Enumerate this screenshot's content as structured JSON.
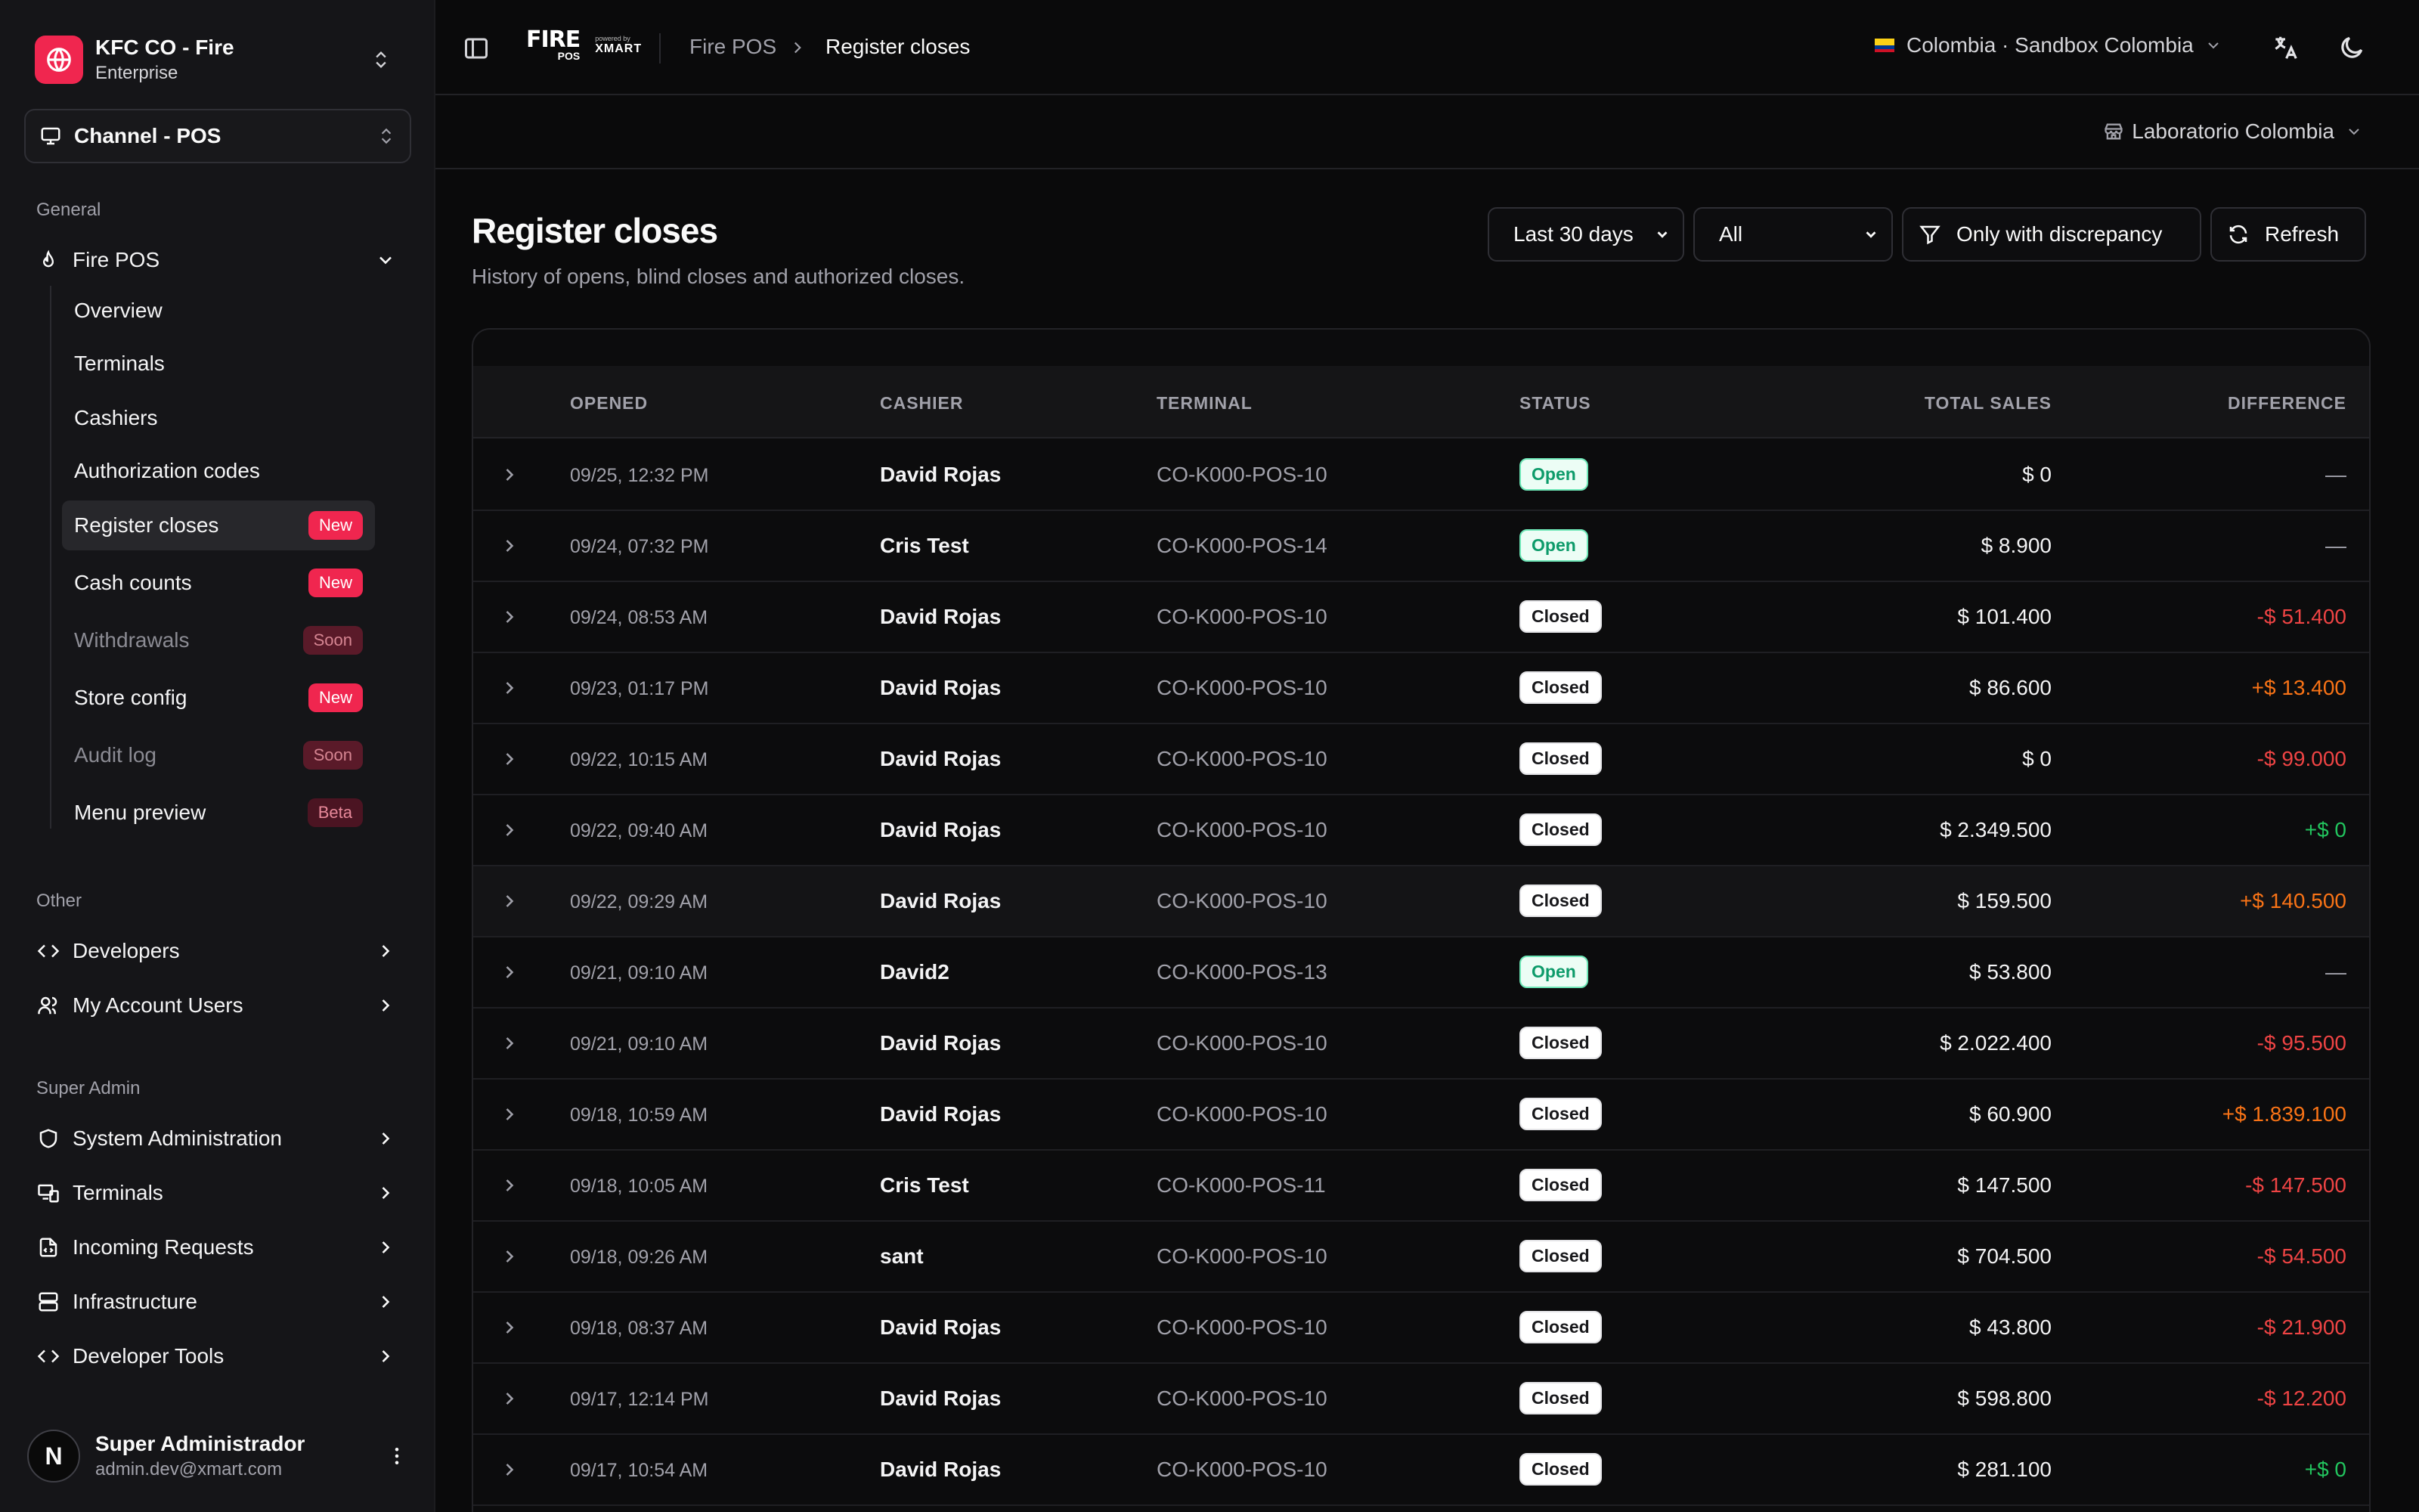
{
  "org": {
    "name": "KFC CO - Fire",
    "plan": "Enterprise"
  },
  "channel": {
    "label": "Channel - POS"
  },
  "sidebar": {
    "general_label": "General",
    "fire_pos": "Fire POS",
    "sub_items": [
      {
        "label": "Overview",
        "badge": "",
        "badge_type": "",
        "muted": false,
        "active": false
      },
      {
        "label": "Terminals",
        "badge": "",
        "badge_type": "",
        "muted": false,
        "active": false
      },
      {
        "label": "Cashiers",
        "badge": "",
        "badge_type": "",
        "muted": false,
        "active": false
      },
      {
        "label": "Authorization codes",
        "badge": "",
        "badge_type": "",
        "muted": false,
        "active": false
      },
      {
        "label": "Register closes",
        "badge": "New",
        "badge_type": "new",
        "muted": false,
        "active": true
      },
      {
        "label": "Cash counts",
        "badge": "New",
        "badge_type": "new",
        "muted": false,
        "active": false
      },
      {
        "label": "Withdrawals",
        "badge": "Soon",
        "badge_type": "soon",
        "muted": true,
        "active": false
      },
      {
        "label": "Store config",
        "badge": "New",
        "badge_type": "new",
        "muted": false,
        "active": false
      },
      {
        "label": "Audit log",
        "badge": "Soon",
        "badge_type": "soon",
        "muted": true,
        "active": false
      },
      {
        "label": "Menu preview",
        "badge": "Beta",
        "badge_type": "beta",
        "muted": false,
        "active": false
      }
    ],
    "other_label": "Other",
    "other_items": [
      {
        "label": "Developers",
        "icon": "code-icon"
      },
      {
        "label": "My Account Users",
        "icon": "users-icon"
      }
    ],
    "super_label": "Super Admin",
    "super_items": [
      {
        "label": "System Administration",
        "icon": "shield-icon"
      },
      {
        "label": "Terminals",
        "icon": "devices-icon"
      },
      {
        "label": "Incoming Requests",
        "icon": "file-code-icon"
      },
      {
        "label": "Infrastructure",
        "icon": "server-icon"
      },
      {
        "label": "Developer Tools",
        "icon": "code-icon"
      }
    ]
  },
  "user": {
    "initial": "N",
    "name": "Super Administrador",
    "email": "admin.dev@xmart.com"
  },
  "brand": {
    "fire": "FIRE",
    "pos": "POS",
    "powered": "powered by",
    "xmart": "XMART"
  },
  "breadcrumb": {
    "parent": "Fire POS",
    "current": "Register closes"
  },
  "topbar": {
    "country": "Colombia · Sandbox Colombia"
  },
  "store": {
    "label": "Laboratorio Colombia"
  },
  "page": {
    "title": "Register closes",
    "subtitle": "History of opens, blind closes and authorized closes."
  },
  "filters": {
    "range": "Last 30 days",
    "status": "All",
    "discrepancy": "Only with discrepancy",
    "refresh": "Refresh"
  },
  "table": {
    "headers": {
      "opened": "OPENED",
      "cashier": "CASHIER",
      "terminal": "TERMINAL",
      "status": "STATUS",
      "total": "TOTAL SALES",
      "difference": "DIFFERENCE"
    },
    "rows": [
      {
        "opened": "09/25, 12:32 PM",
        "cashier": "David Rojas",
        "terminal": "CO-K000-POS-10",
        "status": "Open",
        "total": "$ 0",
        "difference": "—",
        "diff_type": "none"
      },
      {
        "opened": "09/24, 07:32 PM",
        "cashier": "Cris Test",
        "terminal": "CO-K000-POS-14",
        "status": "Open",
        "total": "$ 8.900",
        "difference": "—",
        "diff_type": "none"
      },
      {
        "opened": "09/24, 08:53 AM",
        "cashier": "David Rojas",
        "terminal": "CO-K000-POS-10",
        "status": "Closed",
        "total": "$ 101.400",
        "difference": "-$ 51.400",
        "diff_type": "neg"
      },
      {
        "opened": "09/23, 01:17 PM",
        "cashier": "David Rojas",
        "terminal": "CO-K000-POS-10",
        "status": "Closed",
        "total": "$ 86.600",
        "difference": "+$ 13.400",
        "diff_type": "pos"
      },
      {
        "opened": "09/22, 10:15 AM",
        "cashier": "David Rojas",
        "terminal": "CO-K000-POS-10",
        "status": "Closed",
        "total": "$ 0",
        "difference": "-$ 99.000",
        "diff_type": "neg"
      },
      {
        "opened": "09/22, 09:40 AM",
        "cashier": "David Rojas",
        "terminal": "CO-K000-POS-10",
        "status": "Closed",
        "total": "$ 2.349.500",
        "difference": "+$ 0",
        "diff_type": "zero"
      },
      {
        "opened": "09/22, 09:29 AM",
        "cashier": "David Rojas",
        "terminal": "CO-K000-POS-10",
        "status": "Closed",
        "total": "$ 159.500",
        "difference": "+$ 140.500",
        "diff_type": "pos"
      },
      {
        "opened": "09/21, 09:10 AM",
        "cashier": "David2",
        "terminal": "CO-K000-POS-13",
        "status": "Open",
        "total": "$ 53.800",
        "difference": "—",
        "diff_type": "none"
      },
      {
        "opened": "09/21, 09:10 AM",
        "cashier": "David Rojas",
        "terminal": "CO-K000-POS-10",
        "status": "Closed",
        "total": "$ 2.022.400",
        "difference": "-$ 95.500",
        "diff_type": "neg"
      },
      {
        "opened": "09/18, 10:59 AM",
        "cashier": "David Rojas",
        "terminal": "CO-K000-POS-10",
        "status": "Closed",
        "total": "$ 60.900",
        "difference": "+$ 1.839.100",
        "diff_type": "pos"
      },
      {
        "opened": "09/18, 10:05 AM",
        "cashier": "Cris Test",
        "terminal": "CO-K000-POS-11",
        "status": "Closed",
        "total": "$ 147.500",
        "difference": "-$ 147.500",
        "diff_type": "neg"
      },
      {
        "opened": "09/18, 09:26 AM",
        "cashier": "sant",
        "terminal": "CO-K000-POS-10",
        "status": "Closed",
        "total": "$ 704.500",
        "difference": "-$ 54.500",
        "diff_type": "neg"
      },
      {
        "opened": "09/18, 08:37 AM",
        "cashier": "David Rojas",
        "terminal": "CO-K000-POS-10",
        "status": "Closed",
        "total": "$ 43.800",
        "difference": "-$ 21.900",
        "diff_type": "neg"
      },
      {
        "opened": "09/17, 12:14 PM",
        "cashier": "David Rojas",
        "terminal": "CO-K000-POS-10",
        "status": "Closed",
        "total": "$ 598.800",
        "difference": "-$ 12.200",
        "diff_type": "neg"
      },
      {
        "opened": "09/17, 10:54 AM",
        "cashier": "David Rojas",
        "terminal": "CO-K000-POS-10",
        "status": "Closed",
        "total": "$ 281.100",
        "difference": "+$ 0",
        "diff_type": "zero"
      }
    ]
  }
}
